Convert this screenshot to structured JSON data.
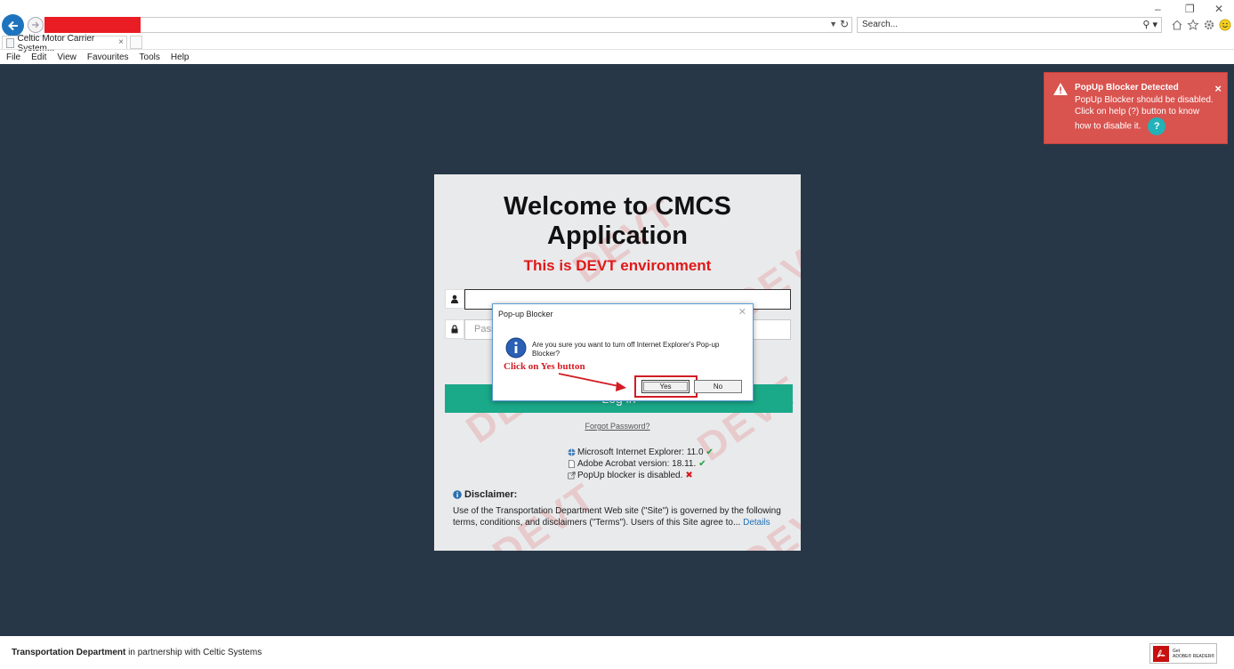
{
  "browser": {
    "search_placeholder": "Search...",
    "tab_title": "Celtic Motor Carrier System...",
    "tab_close": "×",
    "menu": [
      "File",
      "Edit",
      "View",
      "Favourites",
      "Tools",
      "Help"
    ],
    "window_controls": [
      "–",
      "❐",
      "✕"
    ]
  },
  "login": {
    "welcome": "Welcome to CMCS Application",
    "environment": "This is DEVT environment",
    "username_placeholder": "",
    "password_placeholder": "Pass",
    "login_label": "Log in",
    "forgot_password": "Forgot Password?",
    "watermark": "DEVT",
    "checks": [
      {
        "label": "Microsoft Internet Explorer: 11.0",
        "status": "✔"
      },
      {
        "label": "Adobe Acrobat version: 18.11.",
        "status": "✔"
      },
      {
        "label": "PopUp blocker is disabled.",
        "status": "✖"
      }
    ],
    "disclaimer_title": "Disclaimer:",
    "disclaimer_text": "Use of the Transportation Department Web site (\"Site\") is governed by the following terms, conditions, and disclaimers (\"Terms\"). Users of this Site agree to...",
    "details_link": "Details"
  },
  "notification": {
    "title": "PopUp Blocker Detected",
    "line1": "PopUp Blocker should be disabled.",
    "line2": "Click on help (?) button to know how to disable it.",
    "help": "?",
    "close": "×",
    "color": "#d9534f"
  },
  "dialog": {
    "title": "Pop-up Blocker",
    "close": "✕",
    "message": "Are you sure you want to turn off Internet Explorer's Pop-up Blocker?",
    "yes": "Yes",
    "no": "No",
    "annotation": "Click on Yes button"
  },
  "footer": {
    "org": "Transportation Department",
    "partner": " in partnership with Celtic Systems",
    "adobe_get": "Get",
    "adobe_reader": "ADOBE® READER®"
  },
  "colors": {
    "page_bg": "#273747",
    "accent": "#1aa989",
    "env_red": "#e01919"
  }
}
